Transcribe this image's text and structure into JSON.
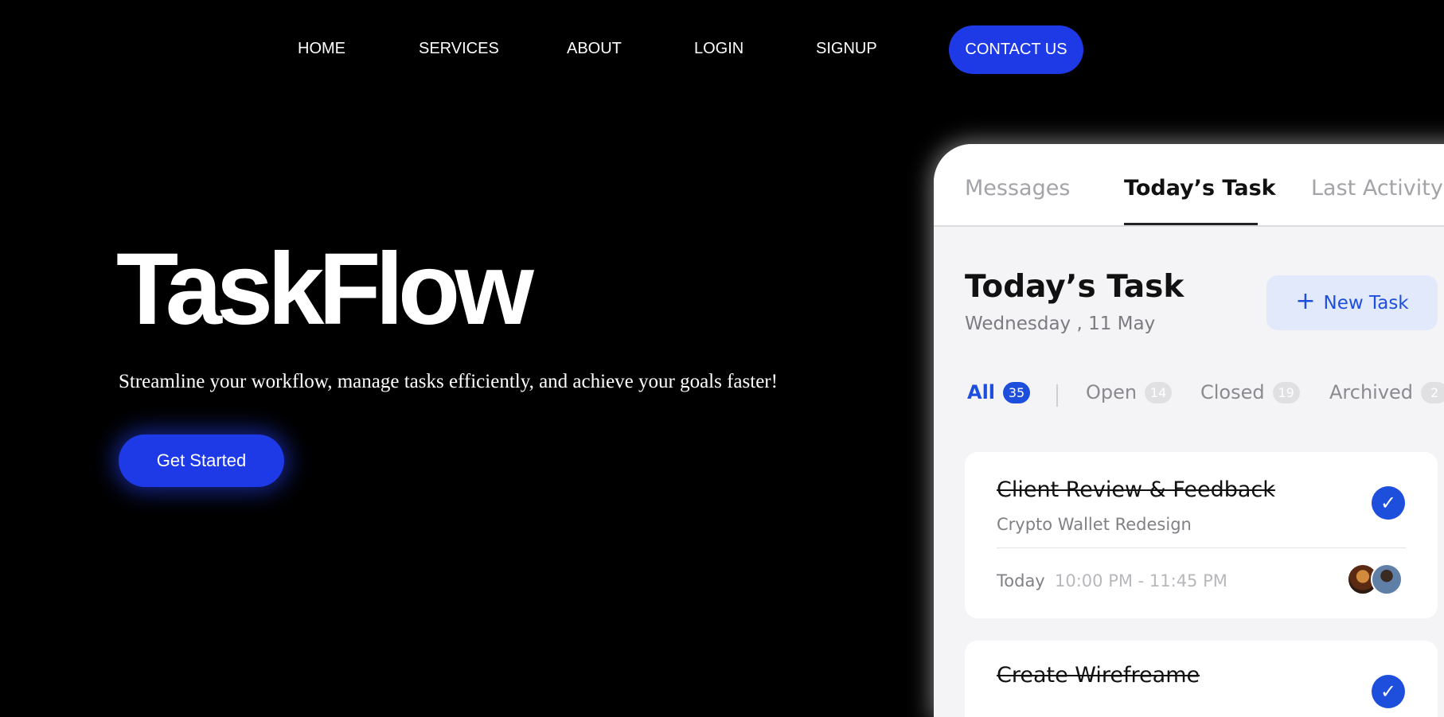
{
  "nav": {
    "links": [
      "HOME",
      "SERVICES",
      "ABOUT",
      "LOGIN",
      "SIGNUP"
    ],
    "cta": "CONTACT US"
  },
  "hero": {
    "title": "TaskFlow",
    "subtitle": "Streamline your workflow, manage tasks efficiently, and achieve your goals faster!",
    "button": "Get Started"
  },
  "app": {
    "tabs": [
      {
        "label": "Messages",
        "active": false
      },
      {
        "label": "Today’s Task",
        "active": true
      },
      {
        "label": "Last Activity",
        "active": false
      }
    ],
    "section_title": "Today’s Task",
    "section_date": "Wednesday , 11 May",
    "new_task_label": "New Task",
    "filters": [
      {
        "label": "All",
        "count": "35",
        "active": true
      },
      {
        "label": "Open",
        "count": "14",
        "active": false
      },
      {
        "label": "Closed",
        "count": "19",
        "active": false
      },
      {
        "label": "Archived",
        "count": "2",
        "active": false
      }
    ],
    "tasks": [
      {
        "title": "Client Review & Feedback",
        "subtitle": "Crypto Wallet Redesign",
        "day": "Today",
        "time": "10:00 PM - 11:45 PM",
        "done": true
      },
      {
        "title": "Create Wirefreame",
        "done": true
      }
    ]
  },
  "colors": {
    "accent": "#1e3ae6",
    "app_accent": "#1e4fdc",
    "background": "#000000"
  }
}
